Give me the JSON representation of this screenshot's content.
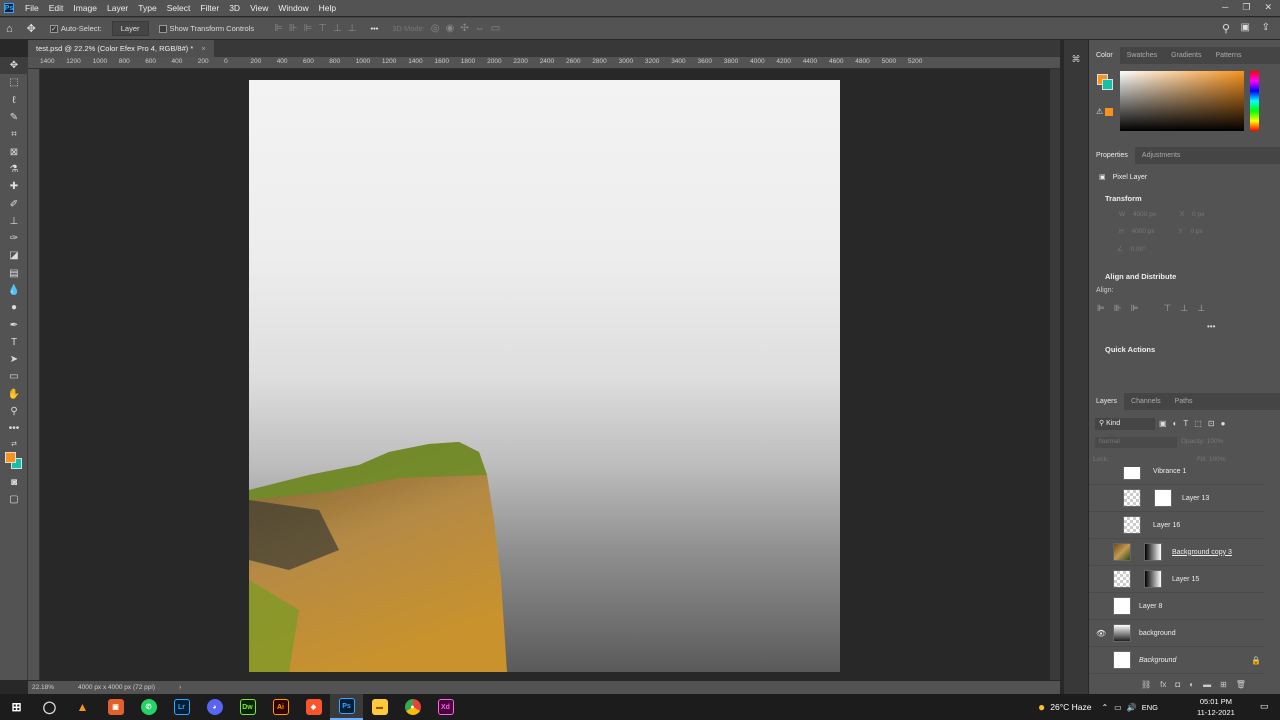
{
  "menu": [
    "File",
    "Edit",
    "Image",
    "Layer",
    "Type",
    "Select",
    "Filter",
    "3D",
    "View",
    "Window",
    "Help"
  ],
  "options": {
    "auto_select_label": "Auto-Select:",
    "layer_dropdown": "Layer",
    "transform_label": "Show Transform Controls",
    "mode_3d": "3D Mode:",
    "more": "•••"
  },
  "document": {
    "tab_title": "test.psd @ 22.2% (Color Efex Pro 4, RGB/8#) *",
    "close": "×"
  },
  "ruler_h": [
    "1400",
    "1200",
    "1000",
    "800",
    "600",
    "400",
    "200",
    "0",
    "200",
    "400",
    "600",
    "800",
    "1000",
    "1200",
    "1400",
    "1600",
    "1800",
    "2000",
    "2200",
    "2400",
    "2600",
    "2800",
    "3000",
    "3200",
    "3400",
    "3600",
    "3800",
    "4000",
    "4200",
    "4400",
    "4600",
    "4800",
    "5000",
    "5200"
  ],
  "status": {
    "zoom": "22.18%",
    "info": "4000 px x 4000 px (72 ppi)"
  },
  "color_panel": {
    "tabs": [
      "Color",
      "Swatches",
      "Gradients",
      "Patterns"
    ],
    "foreground": "#f7931e",
    "background": "#14c1a8"
  },
  "properties": {
    "tabs": [
      "Properties",
      "Adjustments"
    ],
    "pixel_layer": "Pixel Layer",
    "transform": "Transform",
    "w_label": "W",
    "w_value": "4000 px",
    "h_label": "H",
    "h_value": "4000 px",
    "x_label": "X",
    "x_value": "0 px",
    "y_label": "Y",
    "y_value": "0 px",
    "angle": "0.00°",
    "align_title": "Align and Distribute",
    "align_label": "Align:",
    "quick_actions": "Quick Actions"
  },
  "layers": {
    "tabs": [
      "Layers",
      "Channels",
      "Paths"
    ],
    "kind": "Kind",
    "blend": "Normal",
    "opacity_label": "Opacity:",
    "opacity": "100%",
    "lock_label": "Lock:",
    "fill_label": "Fill:",
    "fill": "100%",
    "items": [
      {
        "name": "Vibrance 1"
      },
      {
        "name": "Layer 13"
      },
      {
        "name": "Layer 16"
      },
      {
        "name": "Background copy 3"
      },
      {
        "name": "Layer 15"
      },
      {
        "name": "Layer 8"
      },
      {
        "name": "background"
      },
      {
        "name": "Background"
      }
    ]
  },
  "taskbar": {
    "weather": "26°C Haze",
    "lang": "ENG",
    "time": "05:01 PM",
    "date": "11-12-2021"
  }
}
